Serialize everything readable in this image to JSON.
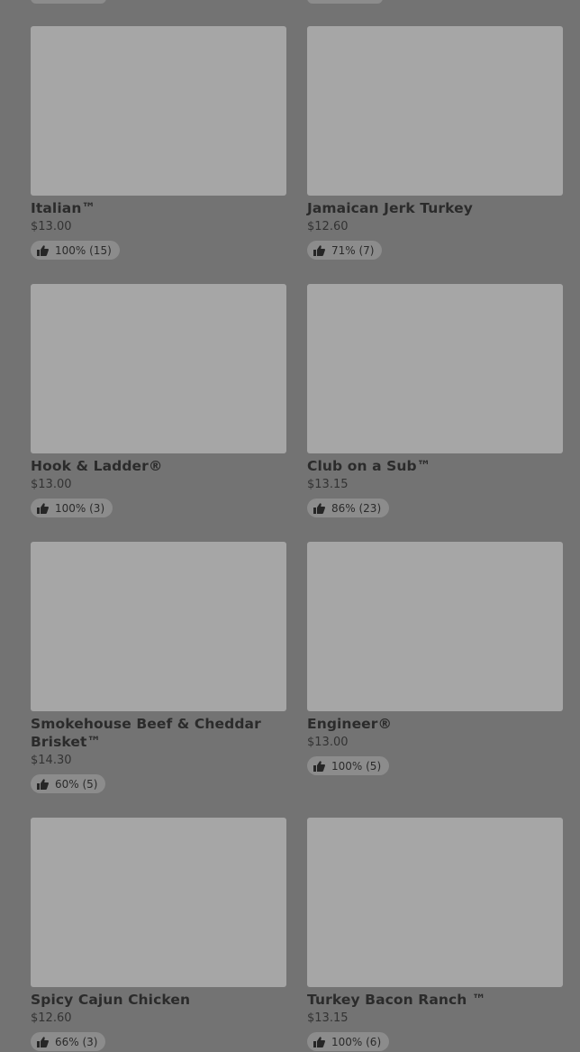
{
  "products": [
    {
      "name": "Italian™",
      "price": "$13.00",
      "rating": "100% (15)"
    },
    {
      "name": "Jamaican Jerk Turkey",
      "price": "$12.60",
      "rating": "71% (7)"
    },
    {
      "name": "Hook & Ladder®",
      "price": "$13.00",
      "rating": "100% (3)"
    },
    {
      "name": "Club on a Sub™",
      "price": "$13.15",
      "rating": "86% (23)"
    },
    {
      "name": "Smokehouse Beef & Cheddar Brisket™",
      "price": "$14.30",
      "rating": "60% (5)"
    },
    {
      "name": "Engineer®",
      "price": "$13.00",
      "rating": "100% (5)"
    },
    {
      "name": "Spicy Cajun Chicken",
      "price": "$12.60",
      "rating": "66% (3)"
    },
    {
      "name": "Turkey Bacon Ranch ™",
      "price": "$13.15",
      "rating": "100% (6)"
    }
  ],
  "icons": {
    "rating": "thumbs-up-icon"
  },
  "colors": {
    "overlay": "#737373",
    "image_placeholder": "#a6a6a6",
    "rating_pill": "#8c8c8c"
  }
}
